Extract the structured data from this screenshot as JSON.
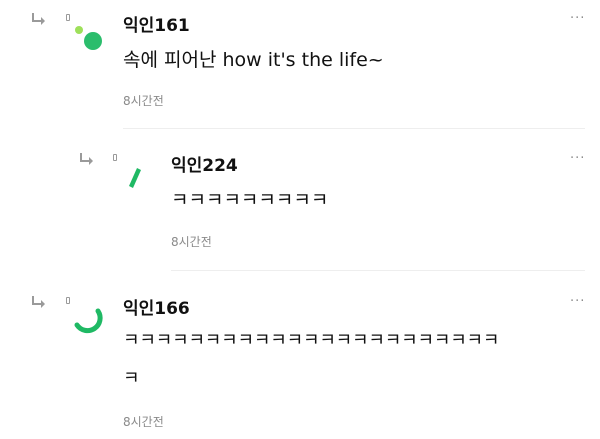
{
  "comments": [
    {
      "nickname": "익인161",
      "text": "속에 피어난 how it's the life~",
      "time": "8시간전",
      "more": "···"
    },
    {
      "nickname": "익인224",
      "text": "ㅋㅋㅋㅋㅋㅋㅋㅋㅋ",
      "time": "8시간전",
      "more": "···"
    },
    {
      "nickname": "익인166",
      "text_line1": "ㅋㅋㅋㅋㅋㅋㅋㅋㅋㅋㅋㅋㅋㅋㅋㅋㅋㅋㅋㅋㅋㅋㅋ",
      "text_line2": "ㅋ",
      "time": "8시간전",
      "more": "···"
    }
  ],
  "colors": {
    "accent_green": "#1fb964",
    "light_green": "#9ee05a",
    "icon_gray": "#9a9a9a"
  },
  "icons": [
    "reply-arrow-icon",
    "small-badge-icon",
    "more-icon"
  ]
}
